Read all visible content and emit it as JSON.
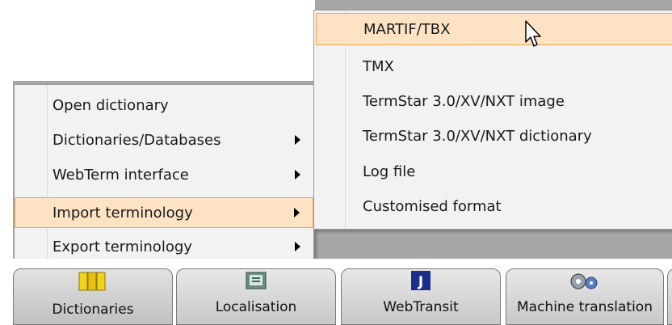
{
  "main_menu": {
    "items": [
      {
        "label": "Open dictionary",
        "has_submenu": false
      },
      {
        "label": "Dictionaries/Databases",
        "has_submenu": true
      },
      {
        "label": "WebTerm interface",
        "has_submenu": true
      },
      {
        "label": "Import terminology",
        "has_submenu": true,
        "highlighted": true
      },
      {
        "label": "Export terminology",
        "has_submenu": true
      }
    ]
  },
  "import_submenu": {
    "items": [
      {
        "label": "MARTIF/TBX",
        "highlighted": true
      },
      {
        "label": "TMX"
      },
      {
        "label": "TermStar 3.0/XV/NXT image"
      },
      {
        "label": "TermStar 3.0/XV/NXT dictionary"
      },
      {
        "label": "Log file"
      },
      {
        "label": "Customised format"
      }
    ]
  },
  "tabs": [
    {
      "label": "Dictionaries",
      "icon": "dictionaries-icon",
      "active": true
    },
    {
      "label": "Localisation",
      "icon": "localisation-icon"
    },
    {
      "label": "WebTransit",
      "icon": "webtransit-icon"
    },
    {
      "label": "Machine translation",
      "icon": "machine-translation-icon"
    }
  ],
  "colors": {
    "highlight_fill": "#fde3c4",
    "highlight_border": "#f0a24f",
    "menu_bg": "#f2f2f2",
    "backdrop": "#a7a7a7"
  }
}
